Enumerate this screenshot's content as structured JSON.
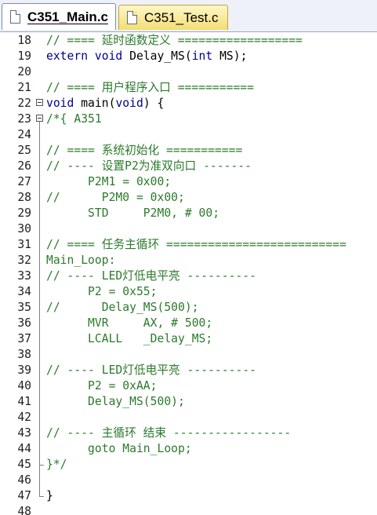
{
  "tabs": [
    {
      "label": "C351_Main.c",
      "active": true
    },
    {
      "label": "C351_Test.c",
      "active": false
    }
  ],
  "lines": [
    {
      "n": "18",
      "text": "// ==== 延时函数定义 ==================",
      "type": "comment"
    },
    {
      "n": "19",
      "text": "extern void Delay_MS(int MS);",
      "type": "code"
    },
    {
      "n": "20",
      "text": "",
      "type": "code"
    },
    {
      "n": "21",
      "text": "// ==== 用户程序入口 ===========",
      "type": "comment"
    },
    {
      "n": "22",
      "text": "void main(void) {",
      "type": "code",
      "fold": true
    },
    {
      "n": "23",
      "text": "/*{ A351",
      "type": "comment",
      "fold": true
    },
    {
      "n": "24",
      "text": "",
      "type": "code"
    },
    {
      "n": "25",
      "text": "// ==== 系统初始化 ===========",
      "type": "comment"
    },
    {
      "n": "26",
      "text": "// ---- 设置P2为准双向口 -------",
      "type": "comment"
    },
    {
      "n": "27",
      "text": "      P2M1 = 0x00;",
      "type": "comment"
    },
    {
      "n": "28",
      "text": "//      P2M0 = 0x00;",
      "type": "comment"
    },
    {
      "n": "29",
      "text": "      STD     P2M0, # 00;",
      "type": "comment"
    },
    {
      "n": "30",
      "text": "",
      "type": "code"
    },
    {
      "n": "31",
      "text": "// ==== 任务主循环 ==========================",
      "type": "comment"
    },
    {
      "n": "32",
      "text": "Main_Loop:",
      "type": "comment"
    },
    {
      "n": "33",
      "text": "// ---- LED灯低电平亮 ----------",
      "type": "comment"
    },
    {
      "n": "34",
      "text": "      P2 = 0x55;",
      "type": "comment"
    },
    {
      "n": "35",
      "text": "//      Delay_MS(500);",
      "type": "comment"
    },
    {
      "n": "36",
      "text": "      MVR     AX, # 500;",
      "type": "comment"
    },
    {
      "n": "37",
      "text": "      LCALL   _Delay_MS;",
      "type": "comment"
    },
    {
      "n": "38",
      "text": "",
      "type": "code"
    },
    {
      "n": "39",
      "text": "// ---- LED灯低电平亮 ----------",
      "type": "comment"
    },
    {
      "n": "40",
      "text": "      P2 = 0xAA;",
      "type": "comment"
    },
    {
      "n": "41",
      "text": "      Delay_MS(500);",
      "type": "comment"
    },
    {
      "n": "42",
      "text": "",
      "type": "code"
    },
    {
      "n": "43",
      "text": "// ---- 主循环 结束 -----------------",
      "type": "comment"
    },
    {
      "n": "44",
      "text": "      goto Main_Loop;",
      "type": "comment"
    },
    {
      "n": "45",
      "text": "}*/",
      "type": "comment"
    },
    {
      "n": "46",
      "text": "",
      "type": "code"
    },
    {
      "n": "47",
      "text": "}",
      "type": "code"
    },
    {
      "n": "48",
      "text": "",
      "type": "code"
    }
  ]
}
